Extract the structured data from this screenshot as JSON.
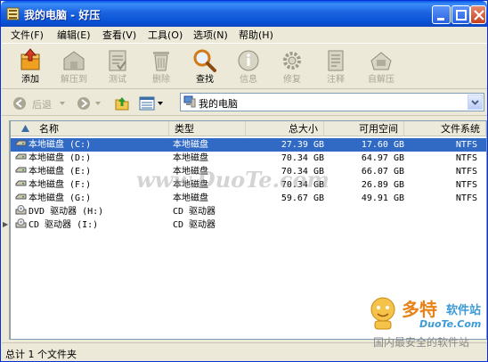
{
  "window": {
    "title": "我的电脑 - 好压"
  },
  "menu": {
    "items": [
      {
        "label": "文件(F)"
      },
      {
        "label": "编辑(E)"
      },
      {
        "label": "查看(V)"
      },
      {
        "label": "工具(O)"
      },
      {
        "label": "选项(N)"
      },
      {
        "label": "帮助(H)"
      }
    ]
  },
  "toolbar": {
    "buttons": [
      {
        "label": "添加",
        "icon": "add-archive-icon",
        "enabled": true
      },
      {
        "label": "解压到",
        "icon": "extract-icon",
        "enabled": false
      },
      {
        "label": "测试",
        "icon": "test-icon",
        "enabled": false
      },
      {
        "label": "删除",
        "icon": "delete-icon",
        "enabled": false
      },
      {
        "label": "查找",
        "icon": "find-icon",
        "enabled": true
      },
      {
        "label": "信息",
        "icon": "info-icon",
        "enabled": false
      },
      {
        "label": "修复",
        "icon": "repair-icon",
        "enabled": false
      },
      {
        "label": "注释",
        "icon": "comment-icon",
        "enabled": false
      },
      {
        "label": "自解压",
        "icon": "sfx-icon",
        "enabled": false
      }
    ]
  },
  "nav": {
    "back_label": "后退",
    "address": "我的电脑"
  },
  "list": {
    "columns": [
      "名称",
      "类型",
      "总大小",
      "可用空间",
      "文件系统"
    ],
    "rows": [
      {
        "name": "本地磁盘 (C:)",
        "type": "本地磁盘",
        "size": "27.39 GB",
        "free": "17.60 GB",
        "fs": "NTFS",
        "icon": "hard-drive-icon",
        "selected": true
      },
      {
        "name": "本地磁盘 (D:)",
        "type": "本地磁盘",
        "size": "70.34 GB",
        "free": "64.97 GB",
        "fs": "NTFS",
        "icon": "hard-drive-icon",
        "selected": false
      },
      {
        "name": "本地磁盘 (E:)",
        "type": "本地磁盘",
        "size": "70.34 GB",
        "free": "66.07 GB",
        "fs": "NTFS",
        "icon": "hard-drive-icon",
        "selected": false
      },
      {
        "name": "本地磁盘 (F:)",
        "type": "本地磁盘",
        "size": "70.34 GB",
        "free": "26.89 GB",
        "fs": "NTFS",
        "icon": "hard-drive-icon",
        "selected": false
      },
      {
        "name": "本地磁盘 (G:)",
        "type": "本地磁盘",
        "size": "59.67 GB",
        "free": "49.91 GB",
        "fs": "NTFS",
        "icon": "hard-drive-icon",
        "selected": false
      },
      {
        "name": "DVD 驱动器 (H:)",
        "type": "CD 驱动器",
        "size": "",
        "free": "",
        "fs": "",
        "icon": "dvd-drive-icon",
        "selected": false
      },
      {
        "name": "CD 驱动器 (I:)",
        "type": "CD 驱动器",
        "size": "",
        "free": "",
        "fs": "",
        "icon": "cd-drive-icon",
        "selected": false
      }
    ]
  },
  "status": {
    "text": "总计 1 个文件夹"
  },
  "watermark": {
    "center": "www.DuoTe.com",
    "brand": "多特",
    "brand_suffix": "软件站",
    "site": "DuoTe.Com",
    "slogan": "国内最安全的软件站"
  },
  "colors": {
    "selection": "#316ac5",
    "titlebar": "#0a5ae8"
  }
}
